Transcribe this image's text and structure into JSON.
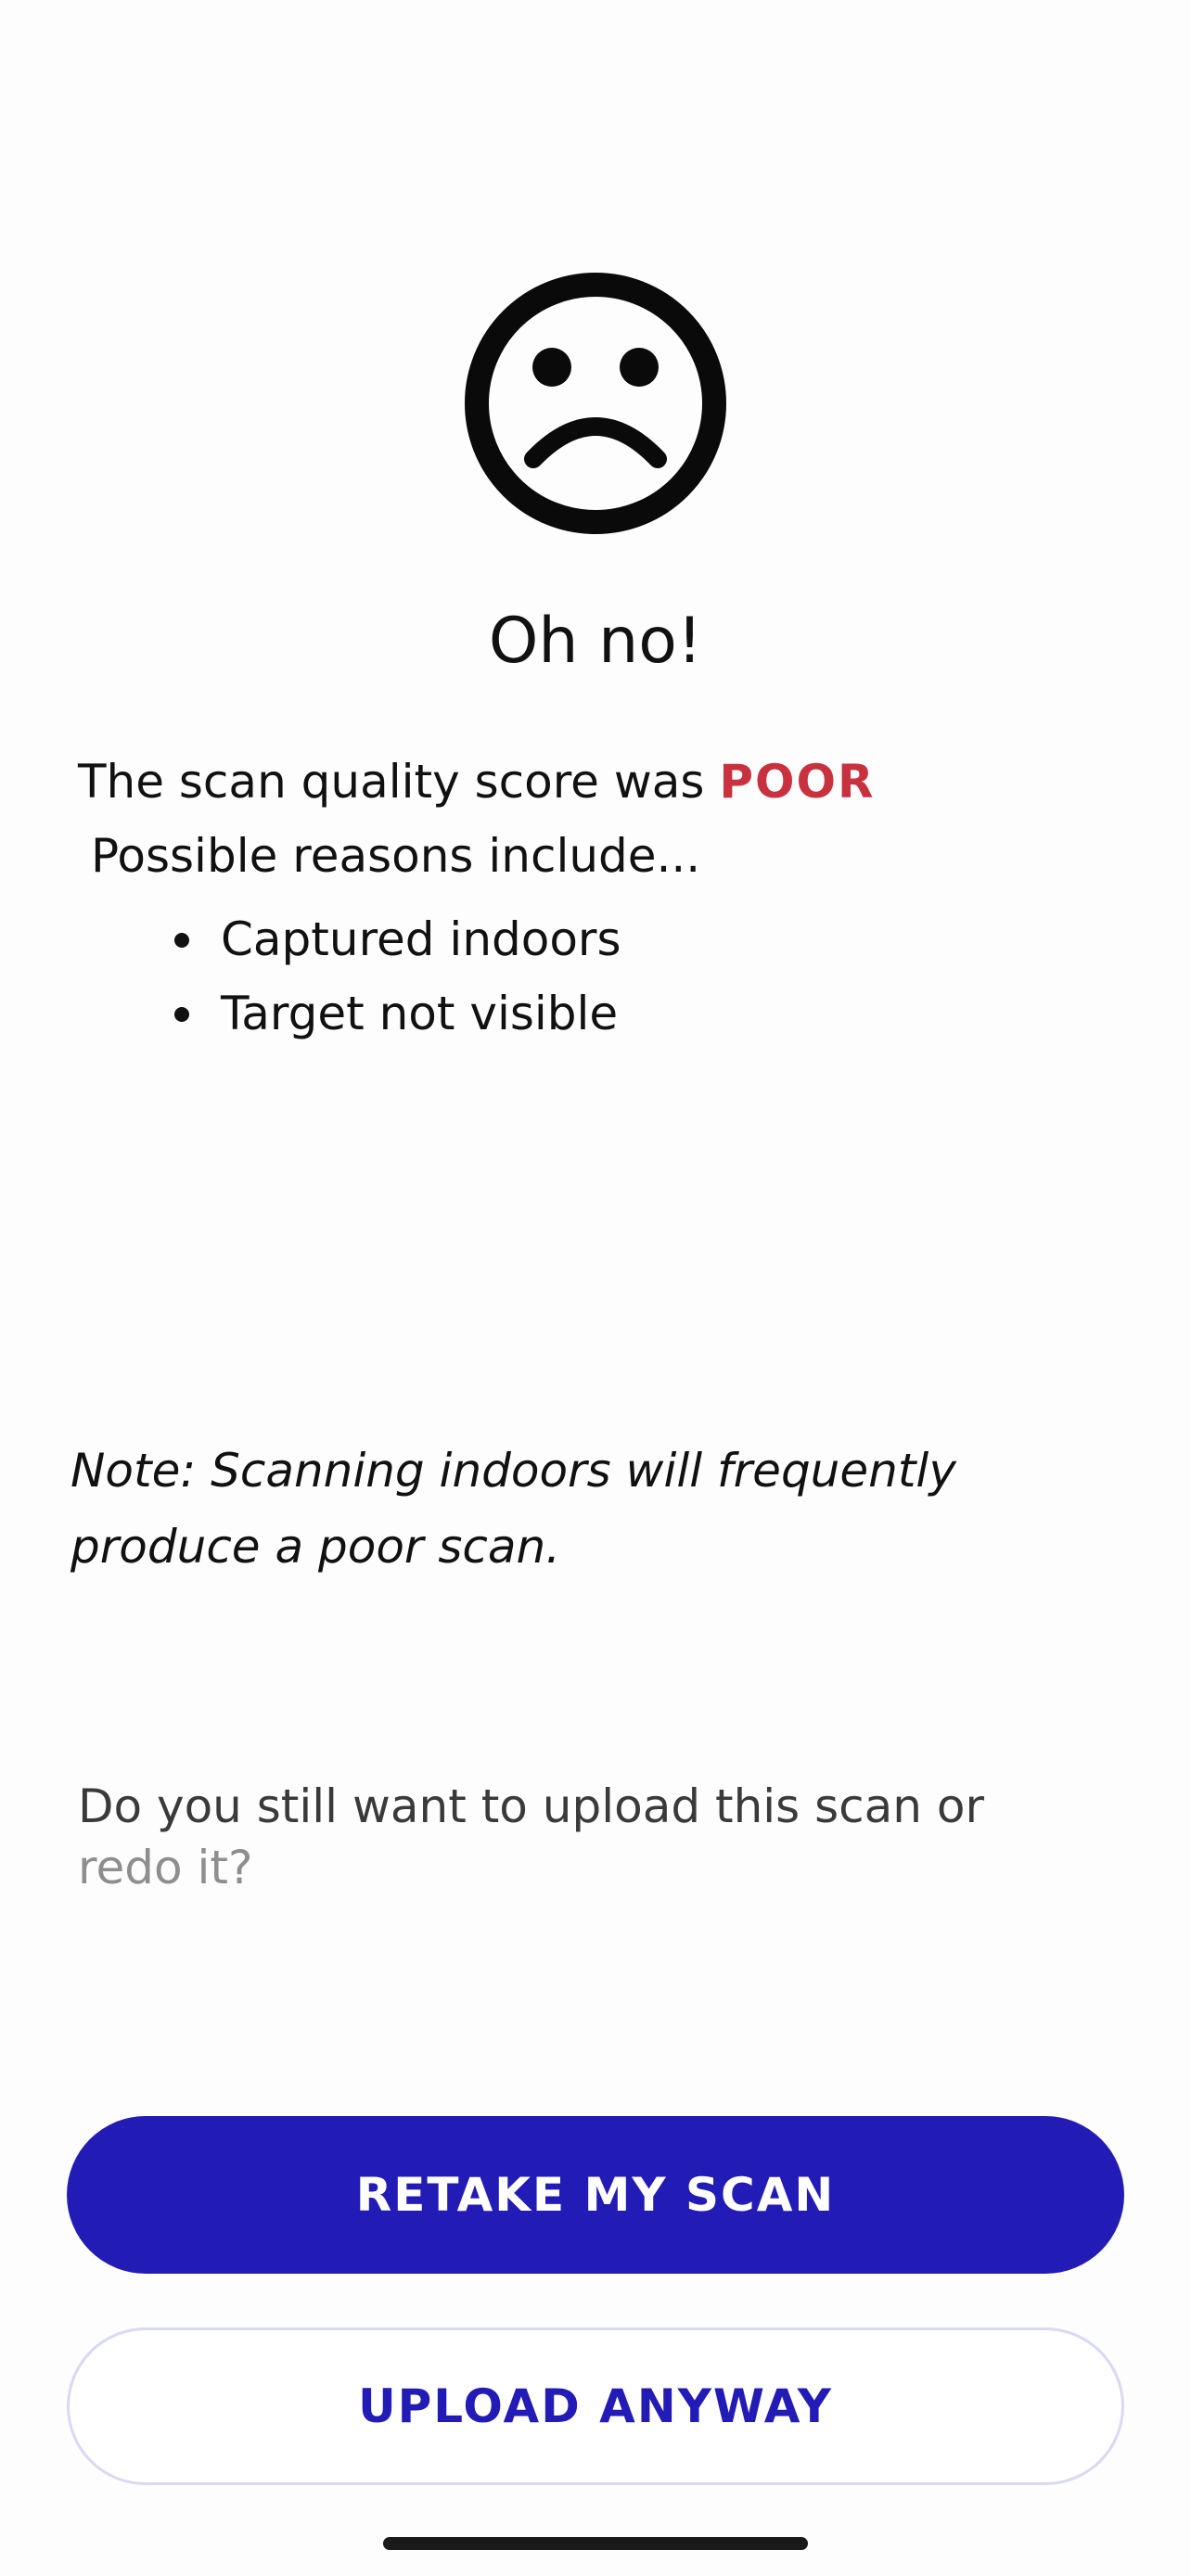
{
  "header": {
    "icon": "sad-face-icon",
    "title": "Oh no!"
  },
  "score": {
    "prefix": "The scan quality score was",
    "value": "POOR",
    "value_color": "#c8323f"
  },
  "reasons": {
    "intro": "Possible reasons include...",
    "items": [
      {
        "label": "Captured indoors"
      },
      {
        "label": "Target not visible"
      }
    ]
  },
  "note": {
    "line1": "Note: Scanning indoors will frequently",
    "line2": "produce a poor scan."
  },
  "question": {
    "line1": "Do you still want to upload this scan or",
    "line2": "redo it?"
  },
  "actions": {
    "retake_label": "RETAKE MY SCAN",
    "upload_label": "UPLOAD ANYWAY",
    "accent_color": "#231bb5"
  }
}
